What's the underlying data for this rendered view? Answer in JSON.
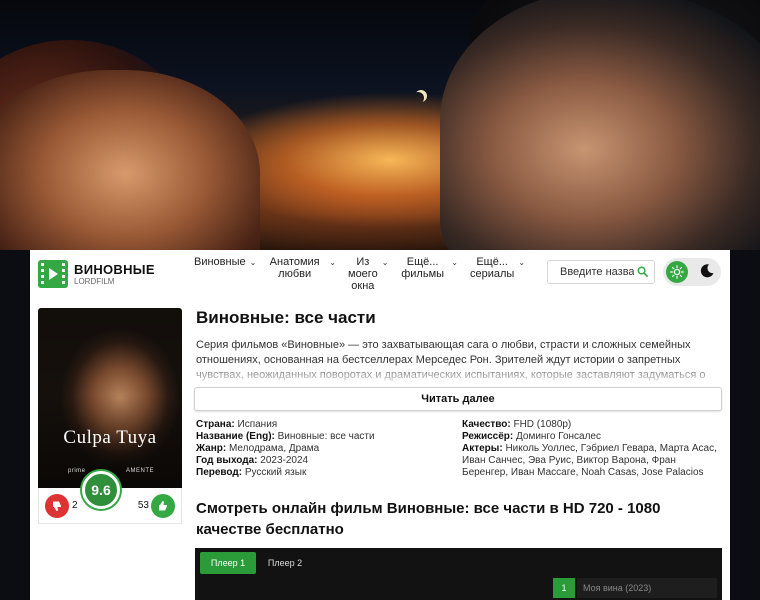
{
  "header": {
    "logo_title": "ВИНОВНЫЕ",
    "logo_subtitle": "LORDFILM",
    "nav": [
      {
        "label": "Виновные"
      },
      {
        "label": "Анатомия любви"
      },
      {
        "label": "Из моего окна"
      },
      {
        "label": "Ещё... фильмы"
      },
      {
        "label": "Ещё... сериалы"
      }
    ],
    "search_placeholder": "Введите назва"
  },
  "movie": {
    "title": "Виновные: все части",
    "description": "Серия фильмов «Виновные» — это захватывающая сага о любви, страсти и сложных семейных отношениях, основанная на бестселлерах Мерседес Рон. Зрителей ждут истории о запретных чувствах, неожиданных поворотах и драматических испытаниях, которые заставляют задуматься о природе",
    "read_more": "Читать далее",
    "poster_title": "Culpa Tuya",
    "poster_brand": "prime",
    "poster_brand2": "AMENTE",
    "rating": "9.6",
    "dislikes": "2",
    "likes": "53",
    "info_left": [
      {
        "label": "Страна:",
        "value": "Испания"
      },
      {
        "label": "Название (Eng):",
        "value": "Виновные: все части"
      },
      {
        "label": "Жанр:",
        "value": "Мелодрама, Драма"
      },
      {
        "label": "Год выхода:",
        "value": "2023-2024"
      },
      {
        "label": "Перевод:",
        "value": "Русский язык"
      }
    ],
    "info_right": [
      {
        "label": "Качество:",
        "value": "FHD (1080p)"
      },
      {
        "label": "Режиссёр:",
        "value": "Доминго Гонсалес"
      },
      {
        "label": "Актеры:",
        "value": "Николь Уоллес, Гэбриел Гевара, Марта Асас, Иван Санчес, Эва Руис, Виктор Варона, Фран Беренгер, Иван Массаге, Noah Casas, Jose Palacios"
      }
    ]
  },
  "watch_heading": "Смотреть онлайн фильм Виновные: все части в HD 720 - 1080 качестве бесплатно",
  "player": {
    "tabs": [
      "Плеер 1",
      "Плеер 2"
    ],
    "episode_number": "1",
    "episode_title": "Моя вина (2023)"
  },
  "colors": {
    "accent": "#33a843",
    "dislike": "#dd3333"
  }
}
